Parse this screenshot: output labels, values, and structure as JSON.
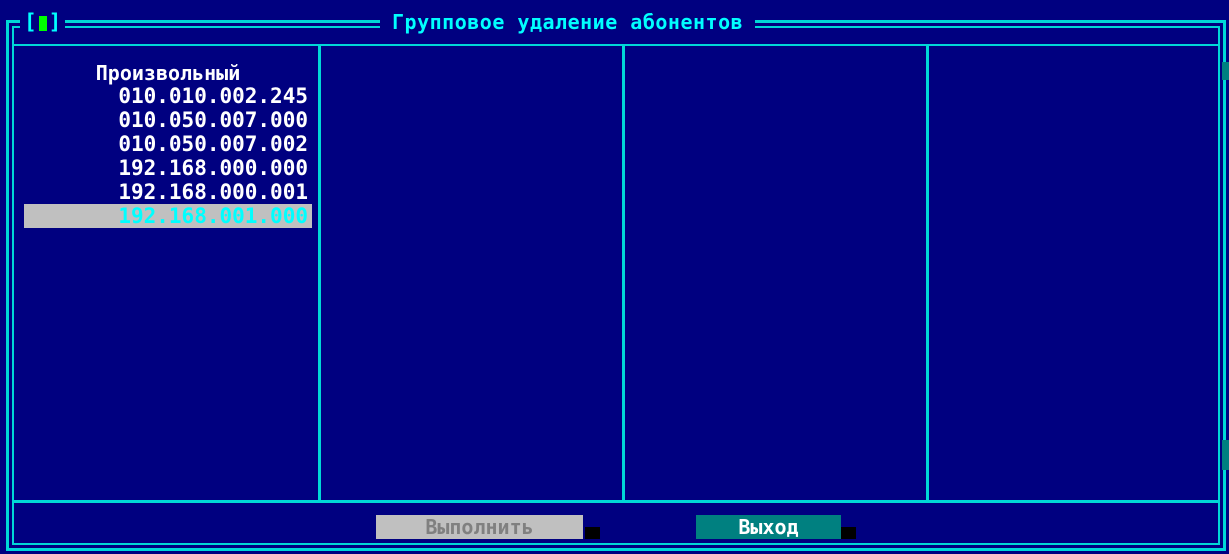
{
  "window": {
    "title": "Групповое удаление абонентов",
    "close_left": "[",
    "close_right": "]"
  },
  "list": {
    "header": "Произвольный",
    "items": [
      "010.010.002.245",
      "010.050.007.000",
      "010.050.007.002",
      "192.168.000.000",
      "192.168.000.001",
      "192.168.001.000"
    ],
    "selected_index": 5
  },
  "buttons": {
    "run_label": "Выполнить",
    "exit_label": "Выход"
  },
  "colors": {
    "background": "#000080",
    "border": "#00d7d7",
    "text": "#ffffff",
    "highlight_text": "#00ffff",
    "selected_bg": "#c0c0c0",
    "active_button": "#008080",
    "close_marker": "#00ff00"
  }
}
